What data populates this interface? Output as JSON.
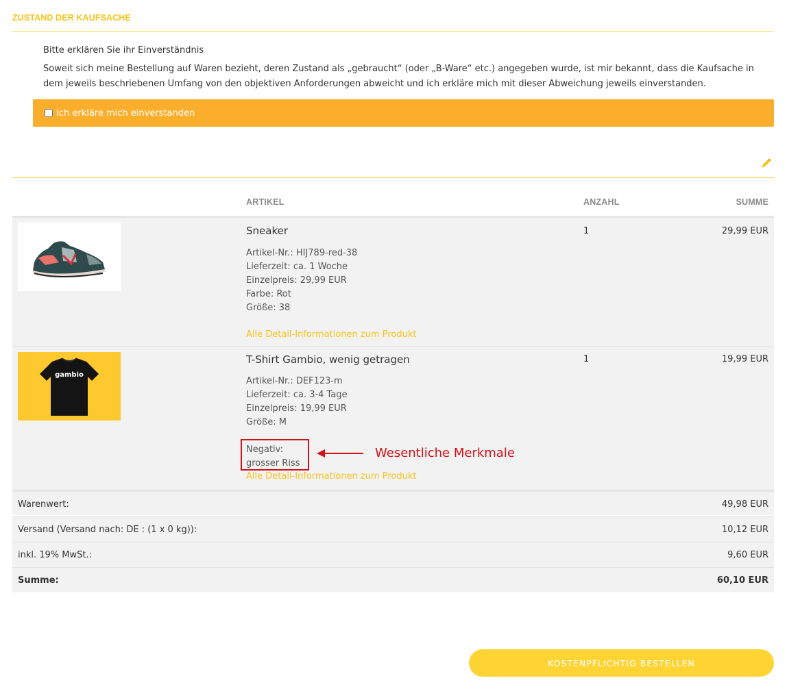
{
  "condition_section": {
    "title": "ZUSTAND DER KAUFSACHE",
    "intro": "Bitte erklären Sie ihr Einverständnis",
    "text": "Soweit sich meine Bestellung auf Waren bezieht, deren Zustand als „gebraucht“ (oder „B-Ware“ etc.) angegeben wurde, ist mir bekannt, dass die Kaufsache in dem jeweils beschriebenen Umfang von den objektiven Anforderungen abweicht und ich erkläre mich mit dieser Abweichung jeweils einverstanden.",
    "checkbox_label": "Ich erkläre mich einverstanden",
    "accent_color": "#fbae2c"
  },
  "cart": {
    "headers": {
      "article": "ARTIKEL",
      "quantity": "ANZAHL",
      "sum": "SUMME"
    },
    "items": [
      {
        "name": "Sneaker",
        "details": [
          "Artikel-Nr.: HIJ789-red-38",
          "Lieferzeit: ca. 1 Woche",
          "Einzelpreis: 29,99 EUR",
          "Farbe: Rot",
          "Größe: 38"
        ],
        "link": "Alle Detail-Informationen zum Produkt",
        "quantity": "1",
        "price": "29,99 EUR"
      },
      {
        "name": "T-Shirt Gambio, wenig getragen",
        "details": [
          "Artikel-Nr.: DEF123-m",
          "Lieferzeit: ca. 3-4 Tage",
          "Einzelpreis: 19,99 EUR",
          "Größe: M"
        ],
        "negative": [
          "Negativ:",
          "grosser Riss"
        ],
        "image_text": "gambio",
        "link": "Alle Detail-Informationen zum Produkt",
        "quantity": "1",
        "price": "19,99 EUR"
      }
    ],
    "annotation": "Wesentliche Merkmale",
    "summary": [
      {
        "label": "Warenwert:",
        "value": "49,98 EUR"
      },
      {
        "label": "Versand (Versand nach: DE : (1 x 0 kg)):",
        "value": "10,12 EUR"
      },
      {
        "label": "inkl. 19% MwSt.:",
        "value": "9,60 EUR"
      },
      {
        "label": "Summe:",
        "value": "60,10 EUR"
      }
    ]
  },
  "order_button": "KOSTENPFLICHTIG BESTELLEN",
  "icons": {
    "edit": "pencil-icon"
  },
  "colors": {
    "brand_yellow": "#f9c31b",
    "button_yellow": "#fdd433",
    "annotation_red": "#d4101a"
  }
}
